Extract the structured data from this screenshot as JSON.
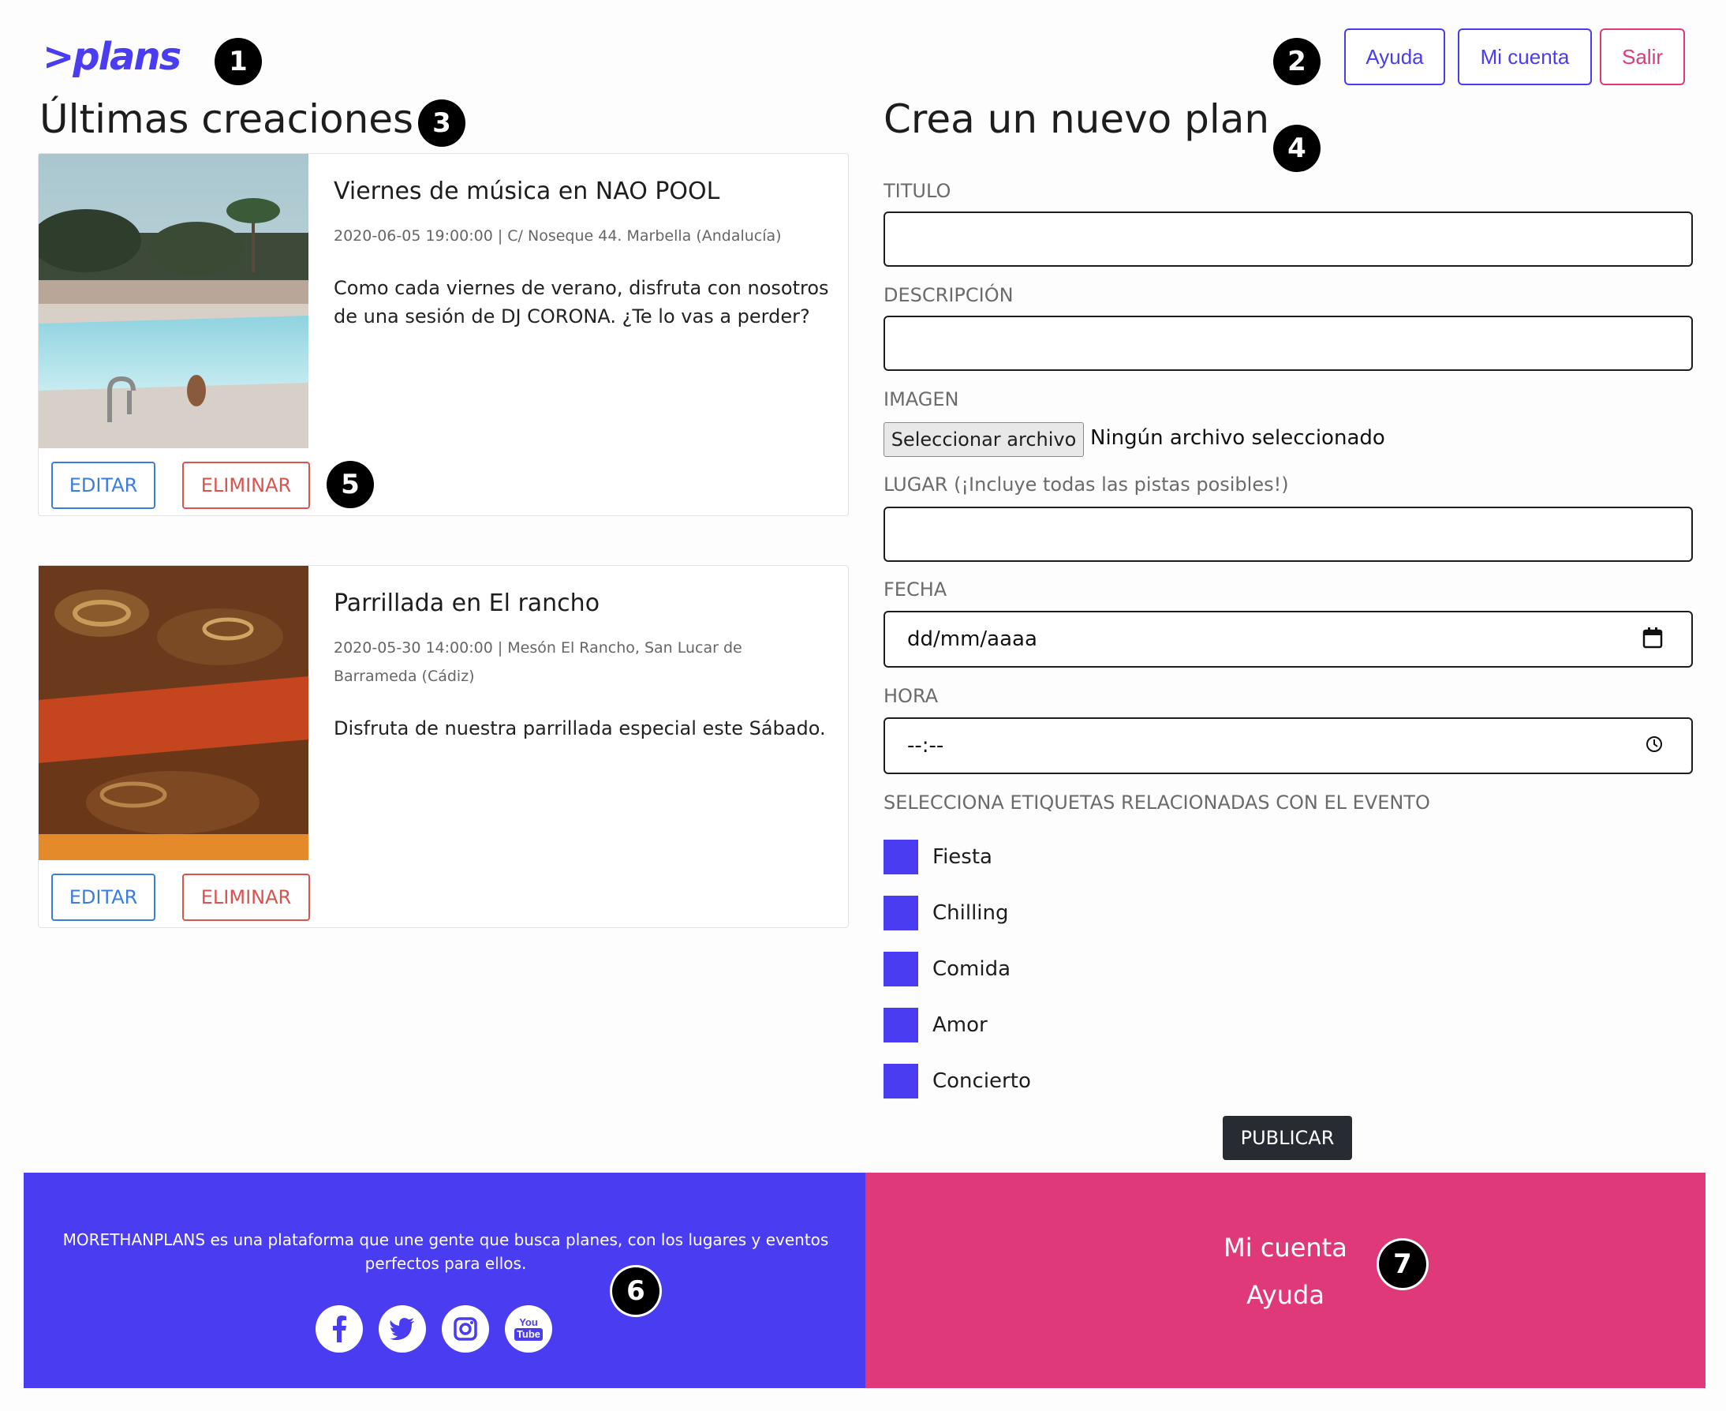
{
  "header": {
    "logo": ">plans",
    "nav": {
      "help": "Ayuda",
      "account": "Mi cuenta",
      "exit": "Salir"
    }
  },
  "markers": [
    "1",
    "2",
    "3",
    "4",
    "5",
    "6",
    "7"
  ],
  "recent": {
    "title": "Últimas creaciones",
    "cards": [
      {
        "title": "Viernes de música en NAO POOL",
        "meta": "2020-06-05 19:00:00 | C/ Noseque 44. Marbella (Andalucía)",
        "description": "Como cada viernes de verano, disfruta con nosotros de una sesión de DJ CORONA. ¿Te lo vas a perder?",
        "edit_label": "EDITAR",
        "delete_label": "ELIMINAR"
      },
      {
        "title": "Parrillada en El rancho",
        "meta": "2020-05-30 14:00:00 | Mesón El Rancho, San Lucar de Barrameda (Cádiz)",
        "description": "Disfruta de nuestra parrillada especial este Sábado.",
        "edit_label": "EDITAR",
        "delete_label": "ELIMINAR"
      }
    ]
  },
  "form": {
    "title": "Crea un nuevo plan",
    "title_label": "TITULO",
    "description_label": "DESCRIPCIÓN",
    "image_label": "IMAGEN",
    "file_button": "Seleccionar archivo",
    "file_status": "Ningún archivo seleccionado",
    "place_label": "LUGAR (¡Incluye todas las pistas posibles!)",
    "date_label": "FECHA",
    "date_value": "dd/mm/aaaa",
    "time_label": "HORA",
    "time_value": "--:--",
    "tags_label": "SELECCIONA ETIQUETAS RELACIONADAS CON EL EVENTO",
    "tags": [
      "Fiesta",
      "Chilling",
      "Comida",
      "Amor",
      "Concierto"
    ],
    "publish_label": "PUBLICAR"
  },
  "footer": {
    "about": "MORETHANPLANS es una plataforma que une gente que busca planes, con los lugares y eventos perfectos para ellos.",
    "social_icons": [
      "facebook-icon",
      "twitter-icon",
      "instagram-icon",
      "youtube-icon"
    ],
    "youtube_text": [
      "You",
      "Tube"
    ],
    "links": {
      "account": "Mi cuenta",
      "help": "Ayuda"
    }
  },
  "colors": {
    "brand": "#4a3cf0",
    "accent": "#e0397a",
    "dark_button": "#272c33"
  }
}
